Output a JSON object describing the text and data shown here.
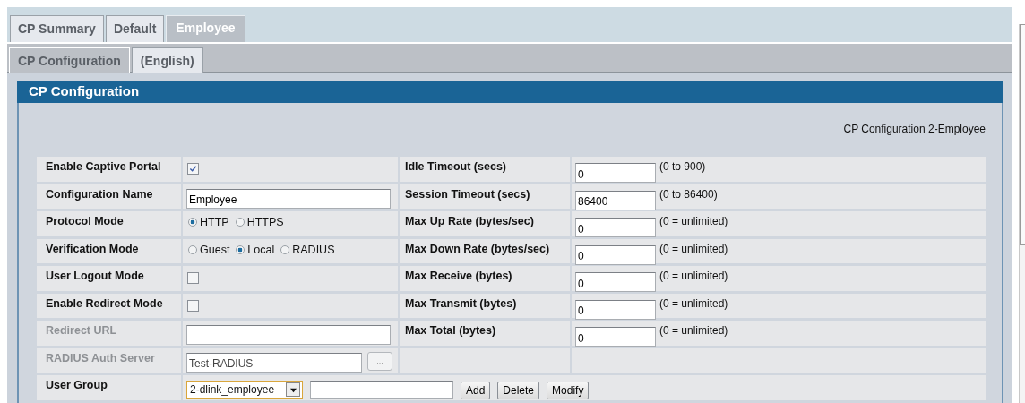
{
  "tabs": [
    {
      "label": "CP Summary",
      "selected": false
    },
    {
      "label": "Default",
      "selected": false
    },
    {
      "label": "Employee",
      "selected": true
    }
  ],
  "subtabs": [
    {
      "label": "CP Configuration",
      "selected": true
    },
    {
      "label": "(English)",
      "selected": false
    }
  ],
  "panel": {
    "title": "CP Configuration",
    "caption": "CP Configuration 2-Employee"
  },
  "rows": [
    {
      "left": {
        "label": "Enable Captive Portal",
        "disabled": false,
        "kind": "checkbox",
        "checked": true
      },
      "right": {
        "label": "Idle Timeout (secs)",
        "value": "0",
        "hint": "(0 to 900)"
      }
    },
    {
      "left": {
        "label": "Configuration Name",
        "disabled": false,
        "kind": "text",
        "value": "Employee"
      },
      "right": {
        "label": "Session Timeout (secs)",
        "value": "86400",
        "hint": "(0 to 86400)"
      }
    },
    {
      "left": {
        "label": "Protocol Mode",
        "disabled": false,
        "kind": "radio",
        "options": [
          {
            "label": "HTTP",
            "selected": true
          },
          {
            "label": "HTTPS",
            "selected": false
          }
        ]
      },
      "right": {
        "label": "Max Up Rate (bytes/sec)",
        "value": "0",
        "hint": "(0 = unlimited)"
      }
    },
    {
      "left": {
        "label": "Verification Mode",
        "disabled": false,
        "kind": "radio",
        "options": [
          {
            "label": "Guest",
            "selected": false
          },
          {
            "label": "Local",
            "selected": true
          },
          {
            "label": "RADIUS",
            "selected": false
          }
        ]
      },
      "right": {
        "label": "Max Down Rate (bytes/sec)",
        "value": "0",
        "hint": "(0 = unlimited)"
      }
    },
    {
      "left": {
        "label": "User Logout Mode",
        "disabled": false,
        "kind": "checkbox",
        "checked": false
      },
      "right": {
        "label": "Max Receive (bytes)",
        "value": "0",
        "hint": "(0 = unlimited)"
      }
    },
    {
      "left": {
        "label": "Enable Redirect Mode",
        "disabled": false,
        "kind": "checkbox",
        "checked": false
      },
      "right": {
        "label": "Max Transmit (bytes)",
        "value": "0",
        "hint": "(0 = unlimited)"
      }
    },
    {
      "left": {
        "label": "Redirect URL",
        "disabled": true,
        "kind": "text"
      },
      "right": {
        "label": "Max Total (bytes)",
        "value": "0",
        "hint": "(0 = unlimited)"
      }
    },
    {
      "left": {
        "label": "RADIUS Auth Server",
        "disabled": true,
        "kind": "browse",
        "value": "Test-RADIUS",
        "button": "..."
      }
    },
    {
      "left": {
        "label": "User Group",
        "disabled": false,
        "kind": "group",
        "select": "2-dlink_employee",
        "buttons": [
          "Add",
          "Delete",
          "Modify"
        ]
      }
    }
  ]
}
